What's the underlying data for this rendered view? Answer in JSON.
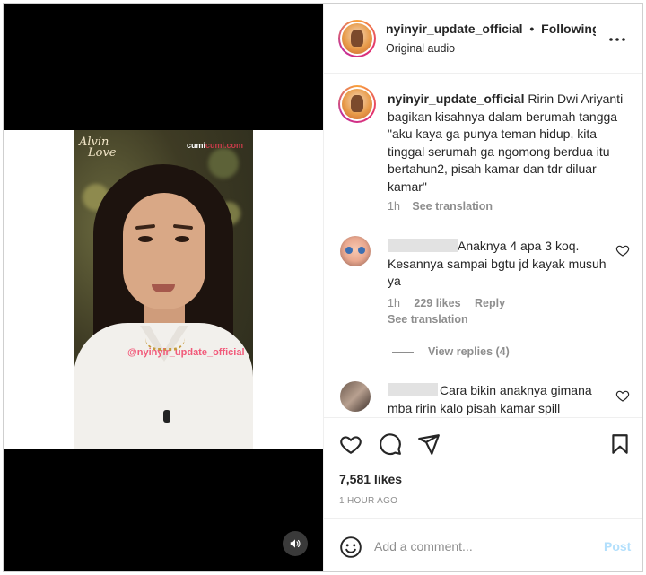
{
  "header": {
    "username": "nyinyir_update_official",
    "separator": "•",
    "follow_status": "Following",
    "subtitle": "Original audio"
  },
  "media": {
    "logo_left_line1": "Alvin",
    "logo_left_line2": "Love",
    "logo_right_prefix": "cumi",
    "logo_right_suffix": "cumi.com",
    "watermark": "@nyinyir_update_official"
  },
  "caption": {
    "username": "nyinyir_update_official",
    "text": "Ririn Dwi Ariyanti bagikan kisahnya dalam berumah tangga \"aku kaya ga punya teman hidup, kita tinggal serumah ga ngomong berdua itu bertahun2, pisah kamar dan tdr diluar kamar\"",
    "time": "1h",
    "translate": "See translation"
  },
  "comments": [
    {
      "text": "Anaknya 4 apa 3 koq. Kesannya sampai bgtu jd kayak musuh ya",
      "time": "1h",
      "likes": "229 likes",
      "reply": "Reply",
      "translate": "See translation",
      "view_replies": "View replies (4)"
    },
    {
      "text": "Cara bikin anaknya gimana mba ririn kalo pisah kamar spill"
    }
  ],
  "actions": {
    "likes": "7,581 likes",
    "time": "1 HOUR AGO"
  },
  "add_comment": {
    "placeholder": "Add a comment...",
    "post": "Post"
  },
  "icons": {
    "more": "more-horizontal-icon",
    "like": "heart-icon",
    "comment": "comment-icon",
    "share": "send-icon",
    "save": "bookmark-icon",
    "emoji": "emoji-icon",
    "sound": "speaker-icon"
  },
  "colors": {
    "text": "#262626",
    "muted": "#8e8e8e",
    "post_disabled": "#b2dffc",
    "watermark": "#f25a7a"
  }
}
